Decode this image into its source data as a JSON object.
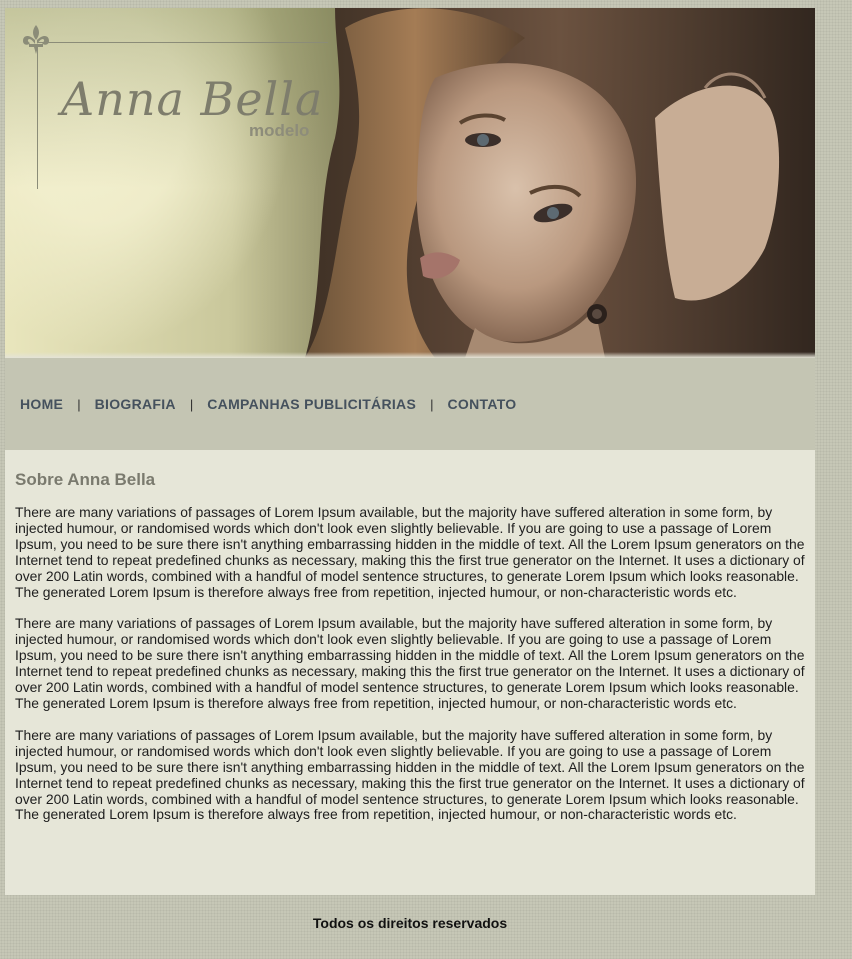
{
  "brand": {
    "name": "Anna Bella",
    "subtitle": "modelo"
  },
  "nav": {
    "items": [
      {
        "label": "HOME"
      },
      {
        "label": "BIOGRAFIA"
      },
      {
        "label": "CAMPANHAS PUBLICITÁRIAS"
      },
      {
        "label": "CONTATO"
      }
    ],
    "separator": "|"
  },
  "main": {
    "title": "Sobre Anna Bella",
    "paragraphs": [
      "There are many variations of passages of Lorem Ipsum available, but the majority have suffered alteration in some form, by injected humour, or randomised words which don't look even slightly believable. If you are going to use a passage of Lorem Ipsum, you need to be sure there isn't anything embarrassing hidden in the middle of text. All the Lorem Ipsum generators on the Internet tend to repeat predefined chunks as necessary, making this the first true generator on the Internet. It uses a dictionary of over 200 Latin words, combined with a handful of model sentence structures, to generate Lorem Ipsum which looks reasonable. The generated Lorem Ipsum is therefore always free from repetition, injected humour, or non-characteristic words etc.",
      "There are many variations of passages of Lorem Ipsum available, but the majority have suffered alteration in some form, by injected humour, or randomised words which don't look even slightly believable. If you are going to use a passage of Lorem Ipsum, you need to be sure there isn't anything embarrassing hidden in the middle of text. All the Lorem Ipsum generators on the Internet tend to repeat predefined chunks as necessary, making this the first true generator on the Internet. It uses a dictionary of over 200 Latin words, combined with a handful of model sentence structures, to generate Lorem Ipsum which looks reasonable. The generated Lorem Ipsum is therefore always free from repetition, injected humour, or non-characteristic words etc.",
      "There are many variations of passages of Lorem Ipsum available, but the majority have suffered alteration in some form, by injected humour, or randomised words which don't look even slightly believable. If you are going to use a passage of Lorem Ipsum, you need to be sure there isn't anything embarrassing hidden in the middle of text. All the Lorem Ipsum generators on the Internet tend to repeat predefined chunks as necessary, making this the first true generator on the Internet. It uses a dictionary of over 200 Latin words, combined with a handful of model sentence structures, to generate Lorem Ipsum which looks reasonable. The generated Lorem Ipsum is therefore always free from repetition, injected humour, or non-characteristic words etc."
    ]
  },
  "footer": {
    "text": "Todos os direitos reservados"
  },
  "icons": {
    "logo_ornament": "fleur-de-lis-icon"
  },
  "colors": {
    "page_bg": "#c6c7b6",
    "nav_bg": "#c4c5b3",
    "content_bg": "#e6e6d8",
    "nav_link": "#45515d",
    "heading": "#7a7a6e"
  }
}
